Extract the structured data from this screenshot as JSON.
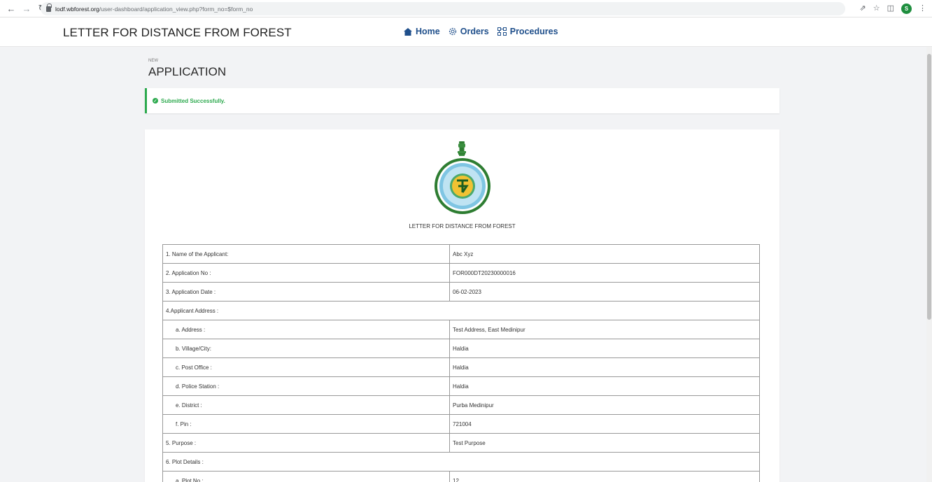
{
  "browser": {
    "url_host": "lodf.wbforest.org",
    "url_path": "/user-dashboard/application_view.php?form_no=$form_no",
    "profile_initial": "S"
  },
  "header": {
    "title": "LETTER FOR DISTANCE FROM FOREST",
    "nav": [
      {
        "label": "Home",
        "icon": "home-icon"
      },
      {
        "label": "Orders",
        "icon": "gear-icon"
      },
      {
        "label": "Procedures",
        "icon": "procedures-icon"
      }
    ]
  },
  "page": {
    "subtitle": "NEW",
    "title": "APPLICATION"
  },
  "alert": {
    "message": "Submitted Successfully.",
    "color": "#2eaa4f"
  },
  "document": {
    "title": "LETTER FOR DISTANCE FROM FOREST",
    "rows": [
      {
        "label": "1. Name of the Applicant:",
        "value": "Abc Xyz"
      },
      {
        "label": "2. Application No :",
        "value": "FOR000DT20230000016"
      },
      {
        "label": "3. Application Date :",
        "value": "06-02-2023"
      },
      {
        "label": "4.Applicant Address :",
        "value": ""
      },
      {
        "label": "a. Address :",
        "value": "Test Address, East Medinipur"
      },
      {
        "label": "b. Village/City:",
        "value": "Haldia"
      },
      {
        "label": "c. Post Office :",
        "value": "Haldia"
      },
      {
        "label": "d. Police Station :",
        "value": "Haldia"
      },
      {
        "label": "e. District :",
        "value": "Purba Medinipur"
      },
      {
        "label": "f. Pin :",
        "value": "721004"
      },
      {
        "label": "5. Purpose :",
        "value": "Test Purpose"
      },
      {
        "label": "6. Plot Details :",
        "value": ""
      },
      {
        "label": "a. Plot No :",
        "value": "12"
      }
    ]
  },
  "colors": {
    "nav_link": "#1f4f8b",
    "seal_green": "#2e7d32"
  }
}
